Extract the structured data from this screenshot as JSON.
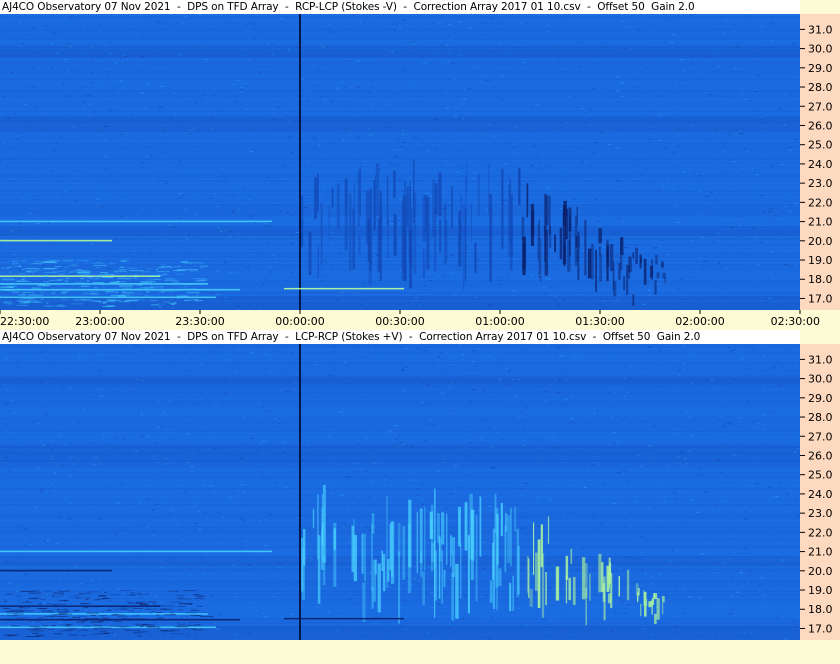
{
  "top_title": "AJ4CO Observatory 07 Nov 2021  -  DPS on TFD Array  -  RCP-LCP (Stokes -V)  -  Correction Array 2017 01 10.csv  -  Offset 50  Gain 2.0",
  "bottom_title": "AJ4CO Observatory 07 Nov 2021  -  DPS on TFD Array  -  LCP-RCP (Stokes +V)  -  Correction Array 2017 01 10.csv  -  Offset 50  Gain 2.0",
  "colors": {
    "background_blue": "#1c6fe6",
    "dark_band": "#1147b4",
    "light_feature": "#49d4ff",
    "bright_feature": "#b8ff9c",
    "dark_feature": "#0a1f6a",
    "frame_bg": "#fdfbd3",
    "scale_bg": "#fdd9bf"
  },
  "chart_data": [
    {
      "type": "heatmap",
      "title": "AJ4CO Observatory 07 Nov 2021  -  DPS on TFD Array  -  RCP-LCP (Stokes -V)  -  Correction Array 2017 01 10.csv  -  Offset 50  Gain 2.0",
      "x_ticks": [
        "22:30:00",
        "23:00:00",
        "23:30:00",
        "00:00:00",
        "00:30:00",
        "01:00:00",
        "01:30:00",
        "02:00:00",
        "02:30:00"
      ],
      "y_ticks": [
        "31.0",
        "30.0",
        "29.0",
        "28.0",
        "27.0",
        "26.0",
        "25.0",
        "24.0",
        "23.0",
        "22.0",
        "21.0",
        "20.0",
        "19.0",
        "18.0",
        "17.0"
      ],
      "ylim": [
        16.4,
        31.8
      ],
      "xlim": [
        "22:30:00",
        "02:30:00"
      ],
      "features": [
        {
          "kind": "dark-streaks",
          "t_start": "00:00:00",
          "t_end": "01:50:00",
          "f_high": 24.5,
          "f_low": 16.6
        }
      ]
    },
    {
      "type": "heatmap",
      "title": "AJ4CO Observatory 07 Nov 2021  -  DPS on TFD Array  -  LCP-RCP (Stokes +V)  -  Correction Array 2017 01 10.csv  -  Offset 50  Gain 2.0",
      "x_ticks": [],
      "y_ticks": [
        "31.0",
        "30.0",
        "29.0",
        "28.0",
        "27.0",
        "26.0",
        "25.0",
        "24.0",
        "23.0",
        "22.0",
        "21.0",
        "20.0",
        "19.0",
        "18.0",
        "17.0"
      ],
      "ylim": [
        16.4,
        31.8
      ],
      "xlim": [
        "22:30:00",
        "02:30:00"
      ],
      "features": [
        {
          "kind": "bright-streaks",
          "t_start": "00:00:00",
          "t_end": "01:50:00",
          "f_high": 24.5,
          "f_low": 16.6
        }
      ]
    }
  ]
}
